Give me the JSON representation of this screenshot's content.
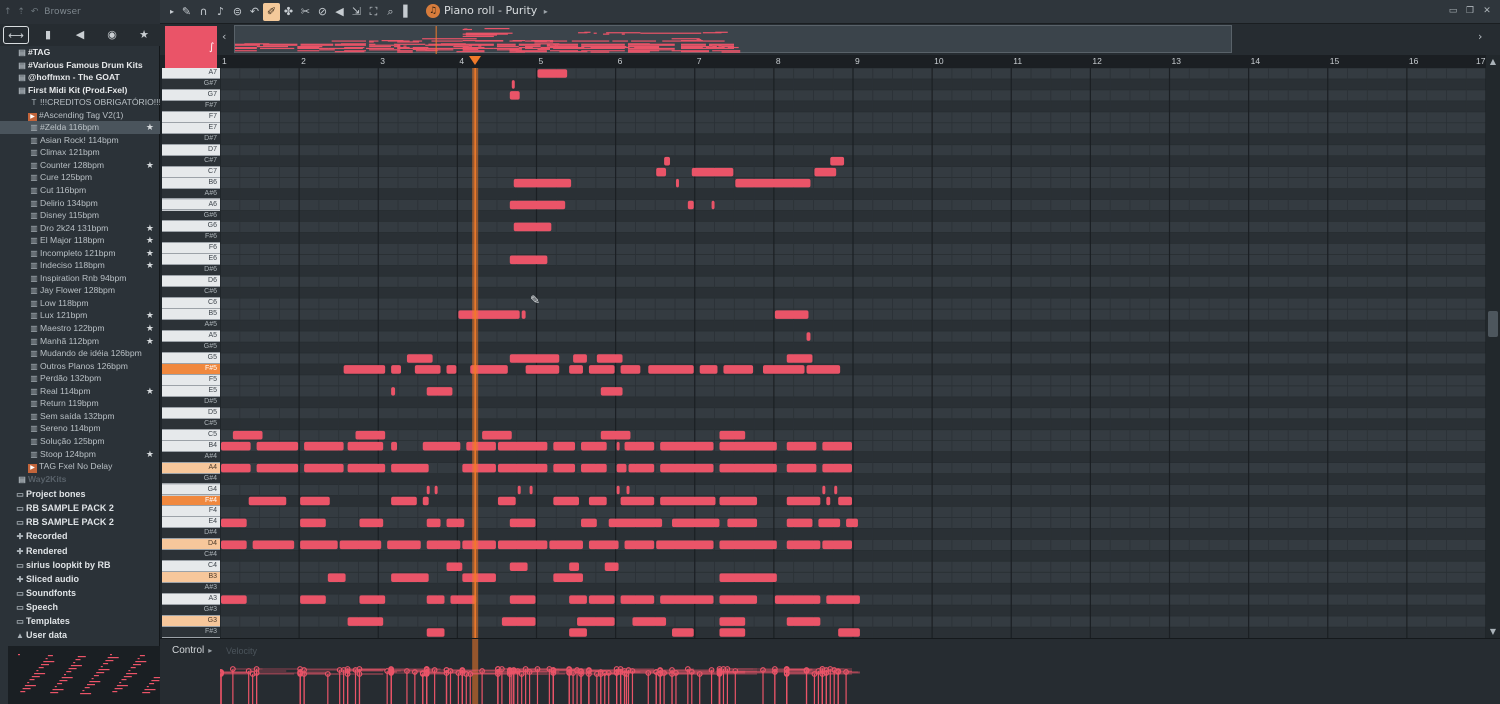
{
  "browser": {
    "title": "Browser",
    "tabs": [
      {
        "name": "tab-all",
        "icon": "⟷",
        "active": true
      },
      {
        "name": "tab-files",
        "icon": "▮"
      },
      {
        "name": "tab-sounds",
        "icon": "◀"
      },
      {
        "name": "tab-web",
        "icon": "◉"
      },
      {
        "name": "tab-favorites",
        "icon": "★"
      }
    ],
    "items": [
      {
        "label": "#TAG",
        "type": "folder",
        "icon": "▤"
      },
      {
        "label": "#Various Famous Drum Kits",
        "type": "folder",
        "icon": "▤"
      },
      {
        "label": "@hoffmxn - The GOAT",
        "type": "folder",
        "icon": "▤"
      },
      {
        "label": "First Midi Kit (Prod.Fxel)",
        "type": "folder",
        "icon": "▤"
      },
      {
        "label": "!!!CREDITOS OBRIGATÓRIO!!!",
        "type": "file",
        "icon": "T"
      },
      {
        "label": "#Ascending Tag V2(1)",
        "type": "file",
        "icon": "▶",
        "orange": true
      },
      {
        "label": "#Zelda 116bpm",
        "type": "midi",
        "icon": "▥",
        "selected": true,
        "star": true
      },
      {
        "label": "Asian Rock! 114bpm",
        "type": "midi",
        "icon": "▥"
      },
      {
        "label": "Climax 121bpm",
        "type": "midi",
        "icon": "▥"
      },
      {
        "label": "Counter 128bpm",
        "type": "midi",
        "icon": "▥",
        "star": true
      },
      {
        "label": "Cure 125bpm",
        "type": "midi",
        "icon": "▥"
      },
      {
        "label": "Cut 116bpm",
        "type": "midi",
        "icon": "▥"
      },
      {
        "label": "Delirio 134bpm",
        "type": "midi",
        "icon": "▥"
      },
      {
        "label": "Disney 115bpm",
        "type": "midi",
        "icon": "▥"
      },
      {
        "label": "Dro 2k24 131bpm",
        "type": "midi",
        "icon": "▥",
        "star": true
      },
      {
        "label": "El Major 118bpm",
        "type": "midi",
        "icon": "▥",
        "star": true
      },
      {
        "label": "Incompleto 121bpm",
        "type": "midi",
        "icon": "▥",
        "star": true
      },
      {
        "label": "Indeciso 118bpm",
        "type": "midi",
        "icon": "▥",
        "star": true
      },
      {
        "label": "Inspiration Rnb 94bpm",
        "type": "midi",
        "icon": "▥"
      },
      {
        "label": "Jay Flower 128bpm",
        "type": "midi",
        "icon": "▥"
      },
      {
        "label": "Low 118bpm",
        "type": "midi",
        "icon": "▥"
      },
      {
        "label": "Lux 121bpm",
        "type": "midi",
        "icon": "▥",
        "star": true
      },
      {
        "label": "Maestro 122bpm",
        "type": "midi",
        "icon": "▥",
        "star": true
      },
      {
        "label": "Manhã 112bpm",
        "type": "midi",
        "icon": "▥",
        "star": true
      },
      {
        "label": "Mudando de idéia 126bpm",
        "type": "midi",
        "icon": "▥"
      },
      {
        "label": "Outros Planos 126bpm",
        "type": "midi",
        "icon": "▥"
      },
      {
        "label": "Perdão 132bpm",
        "type": "midi",
        "icon": "▥"
      },
      {
        "label": "Real 114bpm",
        "type": "midi",
        "icon": "▥",
        "star": true
      },
      {
        "label": "Return 119bpm",
        "type": "midi",
        "icon": "▥"
      },
      {
        "label": "Sem saída 132bpm",
        "type": "midi",
        "icon": "▥"
      },
      {
        "label": "Sereno 114bpm",
        "type": "midi",
        "icon": "▥"
      },
      {
        "label": "Solução 125bpm",
        "type": "midi",
        "icon": "▥"
      },
      {
        "label": "Stoop 124bpm",
        "type": "midi",
        "icon": "▥",
        "star": true
      },
      {
        "label": "TAG Fxel No Delay",
        "type": "file",
        "icon": "▶",
        "orange": true
      },
      {
        "label": "Way2Kits",
        "type": "folder",
        "icon": "▤",
        "dim": true
      }
    ],
    "places": [
      {
        "label": "Project bones",
        "icon": "▭"
      },
      {
        "label": "RB SAMPLE PACK 2",
        "icon": "▭"
      },
      {
        "label": "RB SAMPLE PACK 2",
        "icon": "▭"
      },
      {
        "label": "Recorded",
        "icon": "✚"
      },
      {
        "label": "Rendered",
        "icon": "✚"
      },
      {
        "label": "sirius loopkit by RB",
        "icon": "▭"
      },
      {
        "label": "Sliced audio",
        "icon": "✚"
      },
      {
        "label": "Soundfonts",
        "icon": "▭"
      },
      {
        "label": "Speech",
        "icon": "▭"
      },
      {
        "label": "Templates",
        "icon": "▭"
      },
      {
        "label": "User data",
        "icon": "▲"
      }
    ]
  },
  "toolbar": {
    "tools": [
      "▸",
      "✎",
      "∩",
      "♪",
      "⊜",
      "↶",
      "✐",
      "✤",
      "✂",
      "⊘",
      "◀",
      "⇲",
      "⛶",
      "⌕",
      "▌"
    ],
    "active_tool_index": 6,
    "title": "Piano roll - Purity",
    "title_arrow": "▸",
    "window_buttons": [
      "▭",
      "❐",
      "✕"
    ]
  },
  "ruler": {
    "bars": [
      "1",
      "2",
      "3",
      "4",
      "5",
      "6",
      "7",
      "8",
      "9",
      "10",
      "11",
      "12",
      "13",
      "14",
      "15",
      "16",
      "17"
    ]
  },
  "event_editor": {
    "control_label": "Control",
    "control_caret": "▸",
    "property_label": "Velocity"
  },
  "piano_roll": {
    "note_color": "#ea5468",
    "playhead_color": "#f07a2a",
    "playhead_beat": 12.9,
    "total_beats": 64,
    "top_key": "A7",
    "visible_rows": 52,
    "keys": [
      "A7",
      "G#7",
      "G7",
      "F#7",
      "F7",
      "E7",
      "D#7",
      "D7",
      "C#7",
      "C7",
      "B6",
      "A#6",
      "A6",
      "G#6",
      "G6",
      "F#6",
      "F6",
      "E6",
      "D#6",
      "D6",
      "C#6",
      "C6",
      "B5",
      "A#5",
      "A5",
      "G#5",
      "G5",
      "F#5",
      "F5",
      "E5",
      "D#5",
      "D5",
      "C#5",
      "C5",
      "B4",
      "A#4",
      "A4",
      "G#4",
      "G4",
      "F#4",
      "F4",
      "E4",
      "D#4",
      "D4",
      "C#4",
      "C4",
      "B3",
      "A#3",
      "A3",
      "G#3",
      "G3",
      "F#3"
    ],
    "highlighted_keys": {
      "F#5": "orange",
      "F#4": "orange",
      "A4": "lightorange",
      "D4": "lightorange",
      "B3": "lightorange",
      "G3": "lightorange"
    },
    "notes": [
      [
        "A7",
        16,
        17.6
      ],
      [
        "G7",
        14.6,
        15.2
      ],
      [
        "G#7",
        14.7,
        14.9
      ],
      [
        "C7",
        22,
        22.6
      ],
      [
        "C#7",
        22.4,
        22.8
      ],
      [
        "C7",
        30,
        31.2
      ],
      [
        "C#7",
        30.8,
        31.6
      ],
      [
        "B6",
        14.8,
        17.8
      ],
      [
        "B6",
        26,
        29.9
      ],
      [
        "C7",
        23.8,
        26
      ],
      [
        "B6",
        23,
        23.2
      ],
      [
        "A6",
        14.6,
        17.5
      ],
      [
        "A6",
        23.6,
        24
      ],
      [
        "A6",
        24.8,
        25
      ],
      [
        "G6",
        14.8,
        16.8
      ],
      [
        "E6",
        14.6,
        16.6
      ],
      [
        "B5",
        12,
        15.2
      ],
      [
        "B5",
        15.2,
        15.5
      ],
      [
        "B5",
        28,
        29.8
      ],
      [
        "A5",
        29.6,
        29.9
      ],
      [
        "G5",
        9.4,
        10.8
      ],
      [
        "G5",
        14.6,
        17.2
      ],
      [
        "G5",
        17.8,
        18.6
      ],
      [
        "G5",
        19,
        20.4
      ],
      [
        "G5",
        28.6,
        30
      ],
      [
        "F#5",
        6.2,
        8.4
      ],
      [
        "F#5",
        8.6,
        9.2
      ],
      [
        "F#5",
        9.8,
        11.2
      ],
      [
        "F#5",
        11.4,
        12
      ],
      [
        "F#5",
        12.6,
        14.6
      ],
      [
        "F#5",
        15.4,
        17.2
      ],
      [
        "F#5",
        17.6,
        18.4
      ],
      [
        "F#5",
        18.6,
        20
      ],
      [
        "F#5",
        20.2,
        21.3
      ],
      [
        "F#5",
        21.6,
        24
      ],
      [
        "F#5",
        24.2,
        25.2
      ],
      [
        "F#5",
        25.4,
        27
      ],
      [
        "F#5",
        27.4,
        29.6
      ],
      [
        "F#5",
        29.6,
        31.4
      ],
      [
        "E5",
        8.6,
        8.9
      ],
      [
        "E5",
        10.4,
        11.8
      ],
      [
        "E5",
        19.2,
        20.4
      ],
      [
        "C5",
        0.6,
        2.2
      ],
      [
        "C5",
        6.8,
        8.4
      ],
      [
        "C5",
        13.2,
        14.8
      ],
      [
        "C5",
        19.2,
        20.8
      ],
      [
        "C5",
        25.2,
        26.6
      ],
      [
        "B4",
        0,
        1.6
      ],
      [
        "B4",
        1.8,
        4
      ],
      [
        "B4",
        4.2,
        6.3
      ],
      [
        "B4",
        6.4,
        8.3
      ],
      [
        "B4",
        8.6,
        9
      ],
      [
        "B4",
        10.2,
        12.2
      ],
      [
        "B4",
        12.4,
        14
      ],
      [
        "B4",
        14,
        16.6
      ],
      [
        "B4",
        16.8,
        18
      ],
      [
        "B4",
        18.2,
        19.6
      ],
      [
        "B4",
        20,
        20.2
      ],
      [
        "B4",
        20.4,
        22
      ],
      [
        "B4",
        22.2,
        25
      ],
      [
        "B4",
        25.2,
        28.2
      ],
      [
        "B4",
        28.6,
        30.2
      ],
      [
        "B4",
        30.4,
        32
      ],
      [
        "A4",
        0,
        1.6
      ],
      [
        "A4",
        1.8,
        4
      ],
      [
        "A4",
        4.2,
        6.3
      ],
      [
        "A4",
        6.4,
        8.4
      ],
      [
        "A4",
        8.6,
        10.6
      ],
      [
        "A4",
        12.2,
        14
      ],
      [
        "A4",
        14,
        16.6
      ],
      [
        "A4",
        16.8,
        18
      ],
      [
        "A4",
        18.2,
        19.6
      ],
      [
        "A4",
        20,
        20.6
      ],
      [
        "A4",
        20.6,
        22
      ],
      [
        "A4",
        22.2,
        25
      ],
      [
        "A4",
        25.2,
        28.2
      ],
      [
        "A4",
        28.6,
        30.2
      ],
      [
        "A4",
        30.4,
        32
      ],
      [
        "G4",
        10.4,
        10.6
      ],
      [
        "G4",
        10.8,
        11
      ],
      [
        "G4",
        15,
        15.2
      ],
      [
        "G4",
        15.6,
        15.8
      ],
      [
        "G4",
        20,
        20.2
      ],
      [
        "G4",
        20.5,
        20.7
      ],
      [
        "G4",
        30.4,
        30.6
      ],
      [
        "G4",
        31,
        31.2
      ],
      [
        "F#4",
        1.4,
        3.4
      ],
      [
        "F#4",
        4,
        5.6
      ],
      [
        "F#4",
        8.6,
        10
      ],
      [
        "F#4",
        10.2,
        10.6
      ],
      [
        "F#4",
        14,
        15
      ],
      [
        "F#4",
        16.8,
        18.2
      ],
      [
        "F#4",
        18.6,
        19.6
      ],
      [
        "F#4",
        20.2,
        22
      ],
      [
        "F#4",
        22.2,
        25.1
      ],
      [
        "F#4",
        25.2,
        27.2
      ],
      [
        "F#4",
        28.6,
        30.4
      ],
      [
        "F#4",
        30.6,
        30.9
      ],
      [
        "F#4",
        31.2,
        32
      ],
      [
        "E4",
        0,
        1.4
      ],
      [
        "E4",
        4,
        5.4
      ],
      [
        "E4",
        7,
        8.3
      ],
      [
        "E4",
        10.4,
        11.2
      ],
      [
        "E4",
        11.4,
        12.4
      ],
      [
        "E4",
        14.6,
        16
      ],
      [
        "E4",
        18.2,
        19.1
      ],
      [
        "E4",
        19.6,
        22.4
      ],
      [
        "E4",
        22.8,
        25.3
      ],
      [
        "E4",
        25.6,
        27.2
      ],
      [
        "E4",
        28.6,
        30
      ],
      [
        "E4",
        30.2,
        31.4
      ],
      [
        "E4",
        31.6,
        32.3
      ],
      [
        "D4",
        0,
        1.4
      ],
      [
        "D4",
        1.6,
        3.8
      ],
      [
        "D4",
        4,
        6
      ],
      [
        "D4",
        6,
        8.2
      ],
      [
        "D4",
        8.4,
        10.2
      ],
      [
        "D4",
        10.4,
        12.2
      ],
      [
        "D4",
        12.2,
        14
      ],
      [
        "D4",
        14,
        16.6
      ],
      [
        "D4",
        16.6,
        18.4
      ],
      [
        "D4",
        18.6,
        20.2
      ],
      [
        "D4",
        20.4,
        22
      ],
      [
        "D4",
        22,
        25
      ],
      [
        "D4",
        25.2,
        28.2
      ],
      [
        "D4",
        28.6,
        30.4
      ],
      [
        "D4",
        30.4,
        32
      ],
      [
        "C4",
        11.4,
        12.3
      ],
      [
        "C4",
        14.6,
        15.6
      ],
      [
        "C4",
        17.6,
        18.2
      ],
      [
        "C4",
        19.4,
        20.2
      ],
      [
        "B3",
        5.4,
        6.4
      ],
      [
        "B3",
        8.6,
        10.6
      ],
      [
        "B3",
        12.2,
        14
      ],
      [
        "B3",
        16.8,
        18.4
      ],
      [
        "B3",
        25.2,
        28.2
      ],
      [
        "A3",
        0,
        1.4
      ],
      [
        "A3",
        4,
        5.4
      ],
      [
        "A3",
        7,
        8.4
      ],
      [
        "A3",
        10.4,
        11.4
      ],
      [
        "A3",
        11.6,
        13
      ],
      [
        "A3",
        14.6,
        16
      ],
      [
        "A3",
        17.6,
        18.6
      ],
      [
        "A3",
        18.6,
        20
      ],
      [
        "A3",
        20.2,
        22
      ],
      [
        "A3",
        22.2,
        25
      ],
      [
        "A3",
        25.2,
        27.2
      ],
      [
        "A3",
        28,
        30.4
      ],
      [
        "A3",
        30.6,
        32.4
      ],
      [
        "G3",
        6.4,
        8.3
      ],
      [
        "G3",
        14.2,
        16
      ],
      [
        "G3",
        18,
        20
      ],
      [
        "G3",
        20.8,
        22.6
      ],
      [
        "G3",
        25.2,
        26.6
      ],
      [
        "G3",
        28.6,
        30.4
      ],
      [
        "F#3",
        10.4,
        11.4
      ],
      [
        "F#3",
        17.6,
        18.6
      ],
      [
        "F#3",
        22.8,
        24
      ],
      [
        "F#3",
        25.2,
        26.6
      ],
      [
        "F#3",
        31.2,
        32.4
      ]
    ]
  }
}
